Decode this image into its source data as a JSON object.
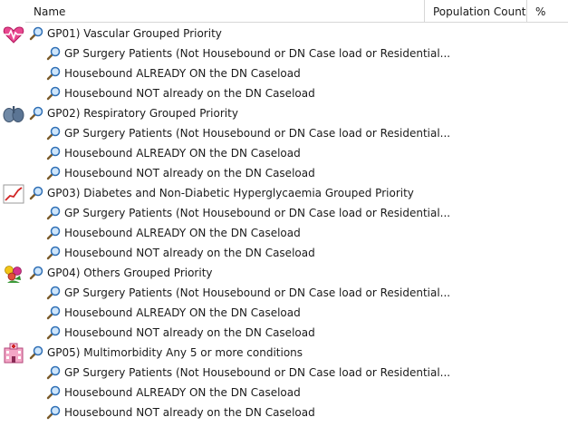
{
  "columns": {
    "name": "Name",
    "population": "Population Count",
    "percent": "%"
  },
  "groups": [
    {
      "label": "GP01) Vascular Grouped Priority",
      "icon": "heart-rate-icon",
      "children": [
        "GP Surgery Patients (Not Housebound or DN Case load or Residential...",
        "Housebound ALREADY ON the DN Caseload",
        "Housebound NOT already on the DN Caseload"
      ]
    },
    {
      "label": "GP02) Respiratory Grouped Priority",
      "icon": "lungs-icon",
      "children": [
        "GP Surgery Patients (Not Housebound or DN Case load or Residential...",
        "Housebound ALREADY ON the DN Caseload",
        "Housebound NOT already on the DN Caseload"
      ]
    },
    {
      "label": "GP03) Diabetes and Non-Diabetic Hyperglycaemia Grouped Priority",
      "icon": "chart-line-icon",
      "children": [
        "GP Surgery Patients (Not Housebound or DN Case load or Residential...",
        "Housebound ALREADY ON the DN Caseload",
        "Housebound NOT already on the DN Caseload"
      ]
    },
    {
      "label": "GP04) Others Grouped Priority",
      "icon": "flowers-icon",
      "children": [
        "GP Surgery Patients (Not Housebound or DN Case load or Residential...",
        "Housebound ALREADY ON the DN Caseload",
        "Housebound NOT already on the DN Caseload"
      ]
    },
    {
      "label": "GP05) Multimorbidity Any 5 or more conditions",
      "icon": "hospital-icon",
      "children": [
        "GP Surgery Patients (Not Housebound or DN Case load or Residential...",
        "Housebound ALREADY ON the DN Caseload",
        "Housebound NOT already on the DN Caseload"
      ]
    }
  ]
}
